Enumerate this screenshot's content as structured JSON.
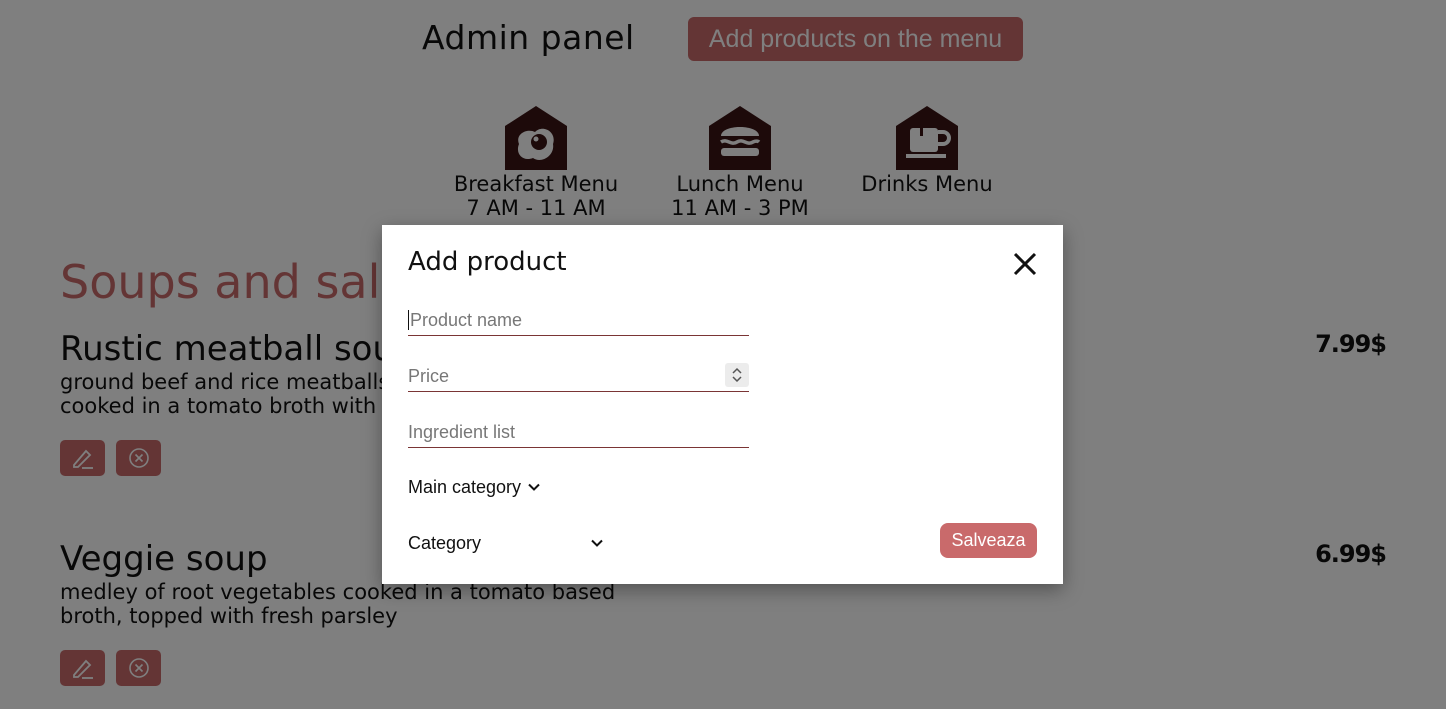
{
  "header": {
    "title": "Admin panel",
    "add_button_label": "Add products on the menu"
  },
  "categories": [
    {
      "name": "Breakfast Menu",
      "hours": "7 AM - 11 AM",
      "icon": "egg-icon"
    },
    {
      "name": "Lunch Menu",
      "hours": "11 AM - 3 PM",
      "icon": "burger-icon"
    },
    {
      "name": "Drinks Menu",
      "hours": "",
      "icon": "coffee-cup-icon"
    }
  ],
  "section": {
    "title": "Soups and salads",
    "products": [
      {
        "name": "Rustic meatball soup",
        "description": "ground beef and rice meatballs with carrots and potato cooked in a tomato broth with fresh parsley",
        "price": "7.99$"
      },
      {
        "name": "Veggie soup",
        "description": "medley of root vegetables cooked in a tomato based broth, topped with fresh parsley",
        "price": "6.99$"
      }
    ]
  },
  "modal": {
    "title": "Add product",
    "product_name_placeholder": "Product name",
    "price_placeholder": "Price",
    "ingredients_placeholder": "Ingredient list",
    "main_category_label": "Main category",
    "category_label": "Category",
    "save_label": "Salveaza"
  },
  "colors": {
    "accent": "#c96a6b",
    "icon_dark": "#3a1414",
    "overlay": "rgba(0,0,0,0.5)"
  }
}
